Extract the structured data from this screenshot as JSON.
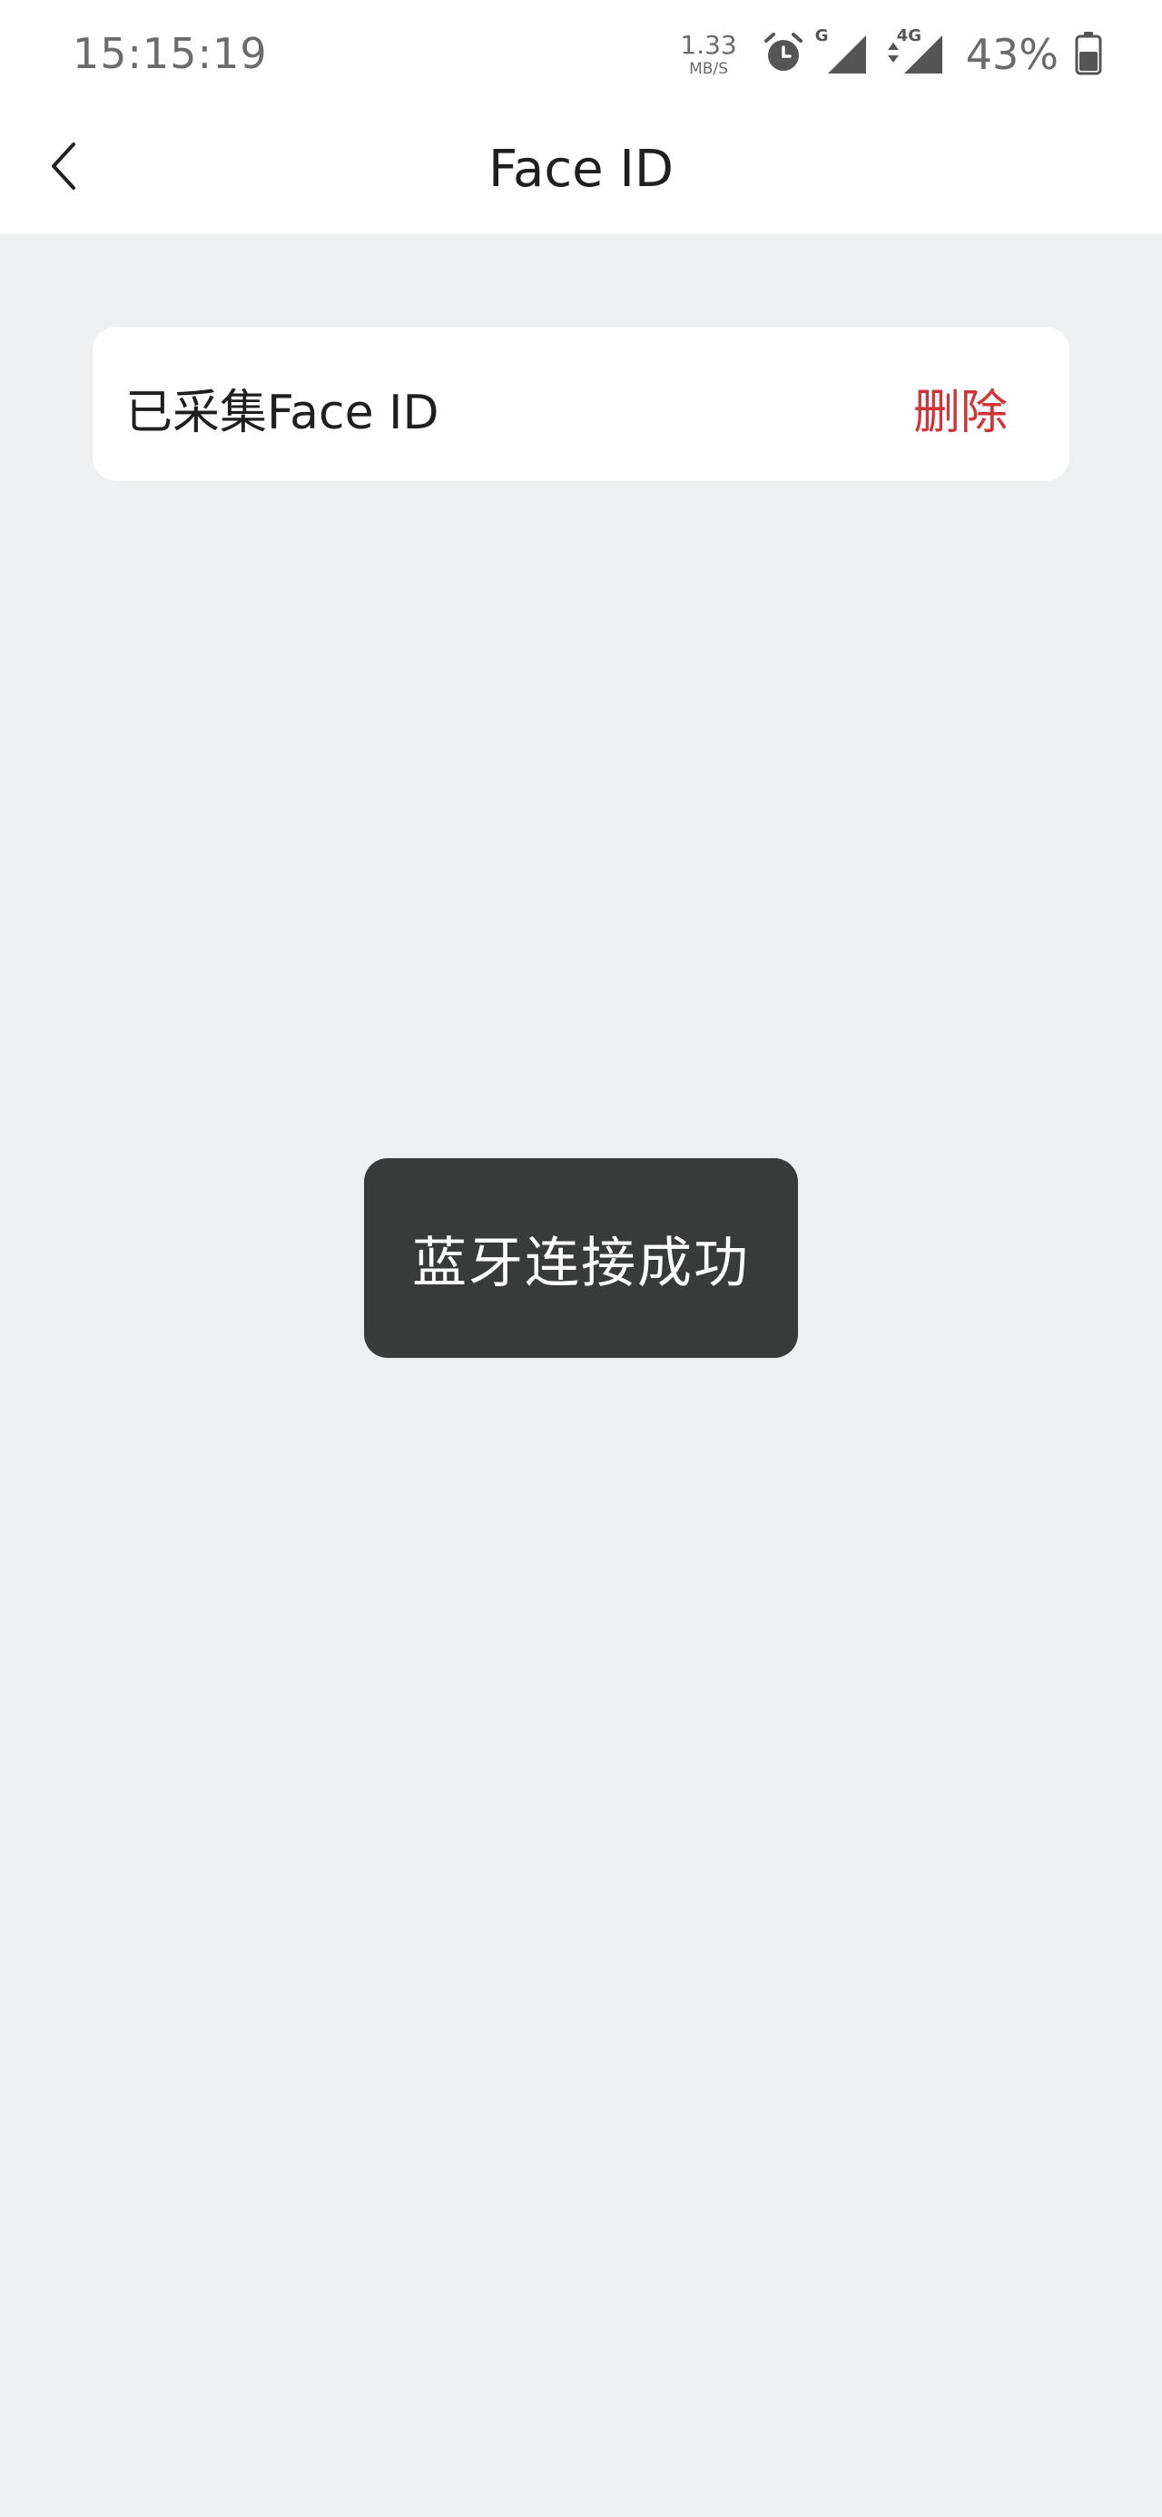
{
  "status_bar": {
    "time": "15:15:19",
    "net_speed_value": "1.33",
    "net_speed_unit": "MB/S",
    "signal1_label": "G",
    "signal2_label": "4G",
    "battery_percent": "43%",
    "icons": [
      "alarm-icon",
      "signal-icon",
      "signal-4g-icon",
      "battery-icon"
    ]
  },
  "nav": {
    "title": "Face ID",
    "back_icon": "chevron-left-icon"
  },
  "card": {
    "label": "已采集Face ID",
    "delete_label": "删除"
  },
  "toast": {
    "message": "蓝牙连接成功"
  },
  "colors": {
    "background": "#eeeff1",
    "surface": "#ffffff",
    "accent_red": "#d0343a",
    "toast_bg": "#393a3a"
  }
}
